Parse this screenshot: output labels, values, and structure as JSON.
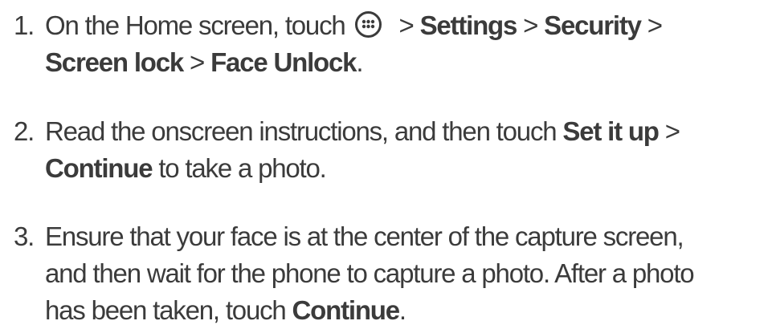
{
  "steps": [
    {
      "number": "1.",
      "line1_pre": "On the Home screen, touch",
      "icon": "apps-icon",
      "line1_sep1": " > ",
      "line1_b1": "Settings",
      "line1_sep2": " > ",
      "line1_b2": "Security",
      "line1_sep3": " >",
      "line2_b1": "Screen lock",
      "line2_sep1": " > ",
      "line2_b2": "Face Unlock",
      "line2_end": "."
    },
    {
      "number": "2.",
      "line1_pre": "Read the onscreen instructions, and then touch ",
      "line1_b1": "Set it up",
      "line1_sep1": " >",
      "line2_b1": "Continue",
      "line2_post": " to take a photo."
    },
    {
      "number": "3.",
      "line1": "Ensure that your face is at the center of the capture screen,",
      "line2": "and then wait for the phone to capture a photo. After a photo",
      "line3_pre": "has been taken, touch ",
      "line3_b1": "Continue",
      "line3_end": "."
    }
  ]
}
